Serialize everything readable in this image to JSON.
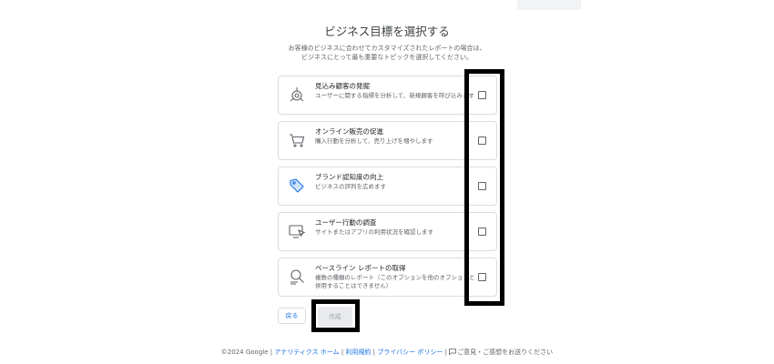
{
  "header": {
    "title": "ビジネス目標を選択する",
    "desc_line1": "お客様のビジネスに合わせてカスタマイズされたレポートの場合は、",
    "desc_line2": "ビジネスにとって最も重要なトピックを選択してください。"
  },
  "objectives": [
    {
      "icon": "target-icon",
      "title": "見込み顧客の発掘",
      "description": "ユーザーに関する指標を分析して、新規顧客を呼び込みます",
      "checked": false
    },
    {
      "icon": "shopping-cart-icon",
      "title": "オンライン販売の促進",
      "description": "購入行動を分析して、売り上げを増やします",
      "checked": false
    },
    {
      "icon": "tag-icon",
      "title": "ブランド認知度の向上",
      "description": "ビジネスの評判を広めます",
      "checked": false
    },
    {
      "icon": "monitor-cursor-icon",
      "title": "ユーザー行動の調査",
      "description": "サイトまたはアプリの利用状況を確認します",
      "checked": false
    },
    {
      "icon": "magnifier-report-icon",
      "title": "ベースライン レポートの取得",
      "description": "複数の種類のレポート（このオプションを他のオプションと併用することはできません）",
      "checked": false
    }
  ],
  "buttons": {
    "back_label": "戻る",
    "create_label": "作成"
  },
  "footer": {
    "copyright": "©2024 Google",
    "sep": "|",
    "analytics_home": "アナリティクス ホーム",
    "terms": "利用規約",
    "privacy": "プライバシー ポリシー",
    "feedback": "ご意見・ご感想をお送りください"
  },
  "colors": {
    "link": "#1a73e8",
    "border": "#dadce0",
    "highlight": "#000000",
    "disabled_bg": "#e8eaed"
  }
}
